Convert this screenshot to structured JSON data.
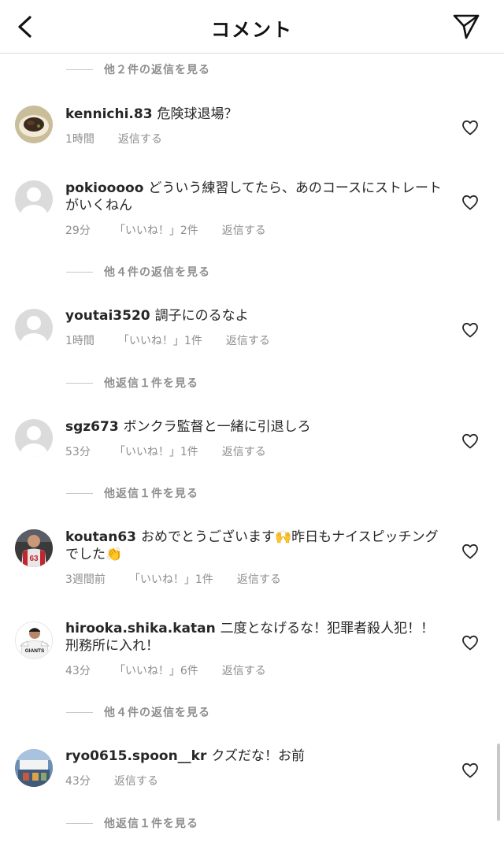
{
  "header": {
    "title": "コメント",
    "back_icon": "chevron-left-icon",
    "send_icon": "paper-plane-icon"
  },
  "replies": [
    {
      "text": "他２件の返信を見る"
    },
    {
      "text": "他４件の返信を見る"
    },
    {
      "text": "他返信１件を見る"
    },
    {
      "text": "他返信１件を見る"
    },
    {
      "text": "他４件の返信を見る"
    },
    {
      "text": "他返信１件を見る"
    }
  ],
  "comments": [
    {
      "username": "kennichi.83",
      "text": "危険球退場？",
      "time": "1時間",
      "likes": "",
      "reply": "返信する"
    },
    {
      "username": "pokiooooo",
      "text": "どういう練習してたら、あのコースにストレートがいくねん",
      "time": "29分",
      "likes": "「いいね！」2件",
      "reply": "返信する"
    },
    {
      "username": "youtai3520",
      "text": "調子にのるなよ",
      "time": "1時間",
      "likes": "「いいね！」1件",
      "reply": "返信する"
    },
    {
      "username": "sgz673",
      "text": "ボンクラ監督と一緒に引退しろ",
      "time": "53分",
      "likes": "「いいね！」1件",
      "reply": "返信する"
    },
    {
      "username": "koutan63",
      "text": "おめでとうございます🙌昨日もナイスピッチングでした👏",
      "time": "3週間前",
      "likes": "「いいね！」1件",
      "reply": "返信する"
    },
    {
      "username": "hirooka.shika.katan",
      "text": "二度となげるな！犯罪者殺人犯！！刑務所に入れ！",
      "time": "43分",
      "likes": "「いいね！」6件",
      "reply": "返信する"
    },
    {
      "username": "ryo0615.spoon__kr",
      "text": "クズだな！お前",
      "time": "43分",
      "likes": "",
      "reply": "返信する"
    }
  ],
  "icons": {
    "like": "heart-outline-icon"
  },
  "colors": {
    "text": "#262626",
    "secondary": "#8e8e8e",
    "divider": "#dbdbdb"
  }
}
